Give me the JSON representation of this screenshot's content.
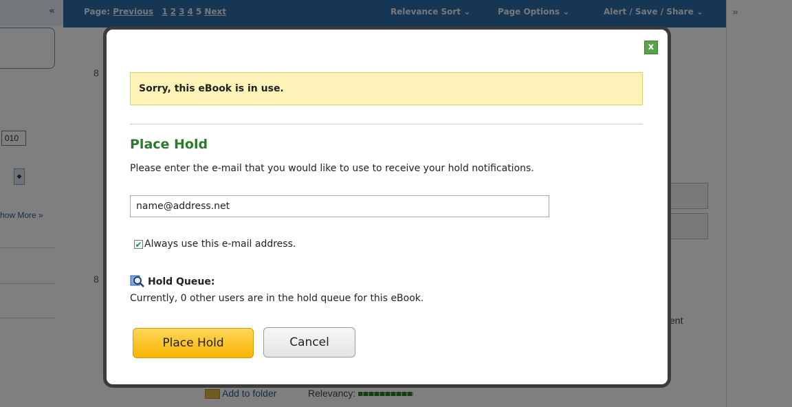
{
  "header": {
    "page_label": "Page:",
    "previous": "Previous",
    "pages": [
      "1",
      "2",
      "3",
      "4",
      "5"
    ],
    "next": "Next",
    "sort": "Relevance Sort ⌄",
    "page_options": "Page Options ⌄",
    "alert": "Alert / Save / Share ⌄"
  },
  "left": {
    "collapse": "«",
    "date_value": "010",
    "show_more": "how More »"
  },
  "right": {
    "expand": "»"
  },
  "results": {
    "num1": "8",
    "num2": "8",
    "partial_text": "ent",
    "add_folder": "Add to folder",
    "relevancy": "Relevancy:"
  },
  "modal": {
    "close": "x",
    "notice": "Sorry, this eBook is in use.",
    "title": "Place Hold",
    "instruction": "Please enter the e-mail that you would like to use to receive your hold notifications.",
    "email_value": "name@address.net",
    "always_label": "Always use this e-mail address.",
    "always_checked": true,
    "queue_title": "Hold Queue:",
    "queue_text": "Currently, 0 other users are in the hold queue for this eBook.",
    "place_hold": "Place Hold",
    "cancel": "Cancel"
  }
}
